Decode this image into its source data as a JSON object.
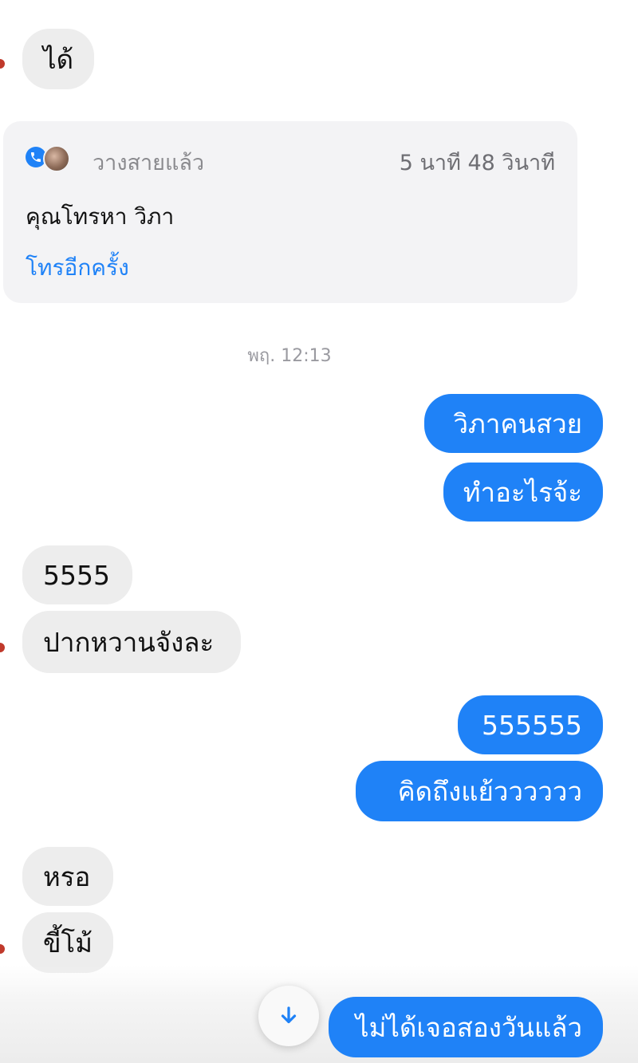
{
  "messages": [
    {
      "id": "m1",
      "direction": "incoming",
      "text": "ได้"
    },
    {
      "id": "m2",
      "direction": "outgoing",
      "text": "วิภาคนสวย"
    },
    {
      "id": "m3",
      "direction": "outgoing",
      "text": "ทำอะไรจ้ะ"
    },
    {
      "id": "m4",
      "direction": "incoming",
      "text": "5555"
    },
    {
      "id": "m5",
      "direction": "incoming",
      "text": "ปากหวานจังละ"
    },
    {
      "id": "m6",
      "direction": "outgoing",
      "text": "555555"
    },
    {
      "id": "m7",
      "direction": "outgoing",
      "text": "คิดถึงแย้วววววว"
    },
    {
      "id": "m8",
      "direction": "incoming",
      "text": "หรอ"
    },
    {
      "id": "m9",
      "direction": "incoming",
      "text": "ขี้โม้"
    },
    {
      "id": "m10",
      "direction": "outgoing",
      "text": "ไม่ได้เจอสองวันแล้ว"
    }
  ],
  "call_card": {
    "status": "วางสายแล้ว",
    "duration": "5 นาที 48 วินาที",
    "title": "คุณโทรหา วิภา",
    "call_again": "โทรอีกครั้ง",
    "icons": [
      "phone-icon",
      "avatar"
    ]
  },
  "timestamp": "พฤ. 12:13",
  "scroll_button": {
    "icon": "arrow-down-icon"
  },
  "colors": {
    "outgoing_bubble": "#1f82f7",
    "incoming_bubble": "#ededed",
    "link": "#1f82f7",
    "call_card_bg": "#f3f3f5"
  }
}
